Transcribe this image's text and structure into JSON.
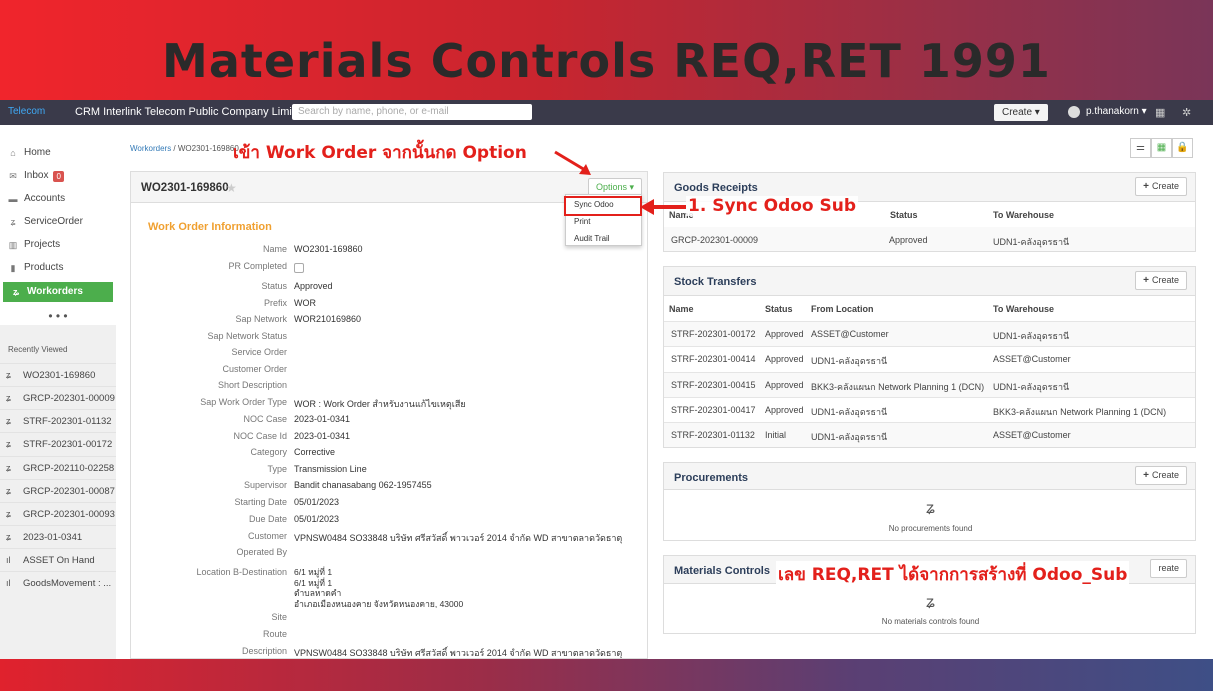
{
  "banner": {
    "title": "Materials Controls REQ,RET 1991"
  },
  "navbar": {
    "logo": "Telecom",
    "company": "CRM Interlink Telecom Public Company Limited",
    "search_placeholder": "Search by name, phone, or e-mail",
    "create_label": "Create ▾",
    "user": "p.thanakorn ▾"
  },
  "sidebar": {
    "items": [
      {
        "label": "Home",
        "icon": "home-icon"
      },
      {
        "label": "Inbox",
        "icon": "envelope-icon",
        "badge": "0"
      },
      {
        "label": "Accounts",
        "icon": "folder-icon"
      },
      {
        "label": "ServiceOrder",
        "icon": "z-icon"
      },
      {
        "label": "Projects",
        "icon": "briefcase-icon"
      },
      {
        "label": "Products",
        "icon": "box-icon"
      },
      {
        "label": "Workorders",
        "icon": "z-icon"
      }
    ],
    "more": "• • •",
    "recent_title": "Recently Viewed",
    "recent": [
      {
        "label": "WO2301-169860"
      },
      {
        "label": "GRCP-202301-00009"
      },
      {
        "label": "STRF-202301-01132"
      },
      {
        "label": "STRF-202301-00172"
      },
      {
        "label": "GRCP-202110-02258"
      },
      {
        "label": "GRCP-202301-00087"
      },
      {
        "label": "GRCP-202301-00093"
      },
      {
        "label": "2023-01-0341"
      },
      {
        "label": "ASSET On Hand"
      },
      {
        "label": "GoodsMovement : ..."
      }
    ]
  },
  "breadcrumb": {
    "link": "Workorders",
    "current": " / WO2301-169860"
  },
  "workorder": {
    "title": "WO2301-169860",
    "options_label": "Options ▾",
    "section_title": "Work Order Information",
    "fields": [
      {
        "label": "Name",
        "value": "WO2301-169860"
      },
      {
        "label": "PR Completed",
        "value": ""
      },
      {
        "label": "Status",
        "value": "Approved"
      },
      {
        "label": "Prefix",
        "value": "WOR"
      },
      {
        "label": "Sap Network",
        "value": "WOR210169860"
      },
      {
        "label": "Sap Network Status",
        "value": ""
      },
      {
        "label": "Service Order",
        "value": ""
      },
      {
        "label": "Customer Order",
        "value": ""
      },
      {
        "label": "Short Description",
        "value": ""
      },
      {
        "label": "Sap Work Order Type",
        "value": "WOR : Work Order สำหรับงานแก้ไขเหตุเสีย"
      },
      {
        "label": "NOC Case",
        "value": "2023-01-0341"
      },
      {
        "label": "NOC Case Id",
        "value": "2023-01-0341"
      },
      {
        "label": "Category",
        "value": "Corrective"
      },
      {
        "label": "Type",
        "value": "Transmission Line"
      },
      {
        "label": "Supervisor",
        "value": "Bandit chanasabang 062-1957455"
      },
      {
        "label": "Starting Date",
        "value": "05/01/2023"
      },
      {
        "label": "Due Date",
        "value": "05/01/2023"
      },
      {
        "label": "Customer",
        "value": "VPNSW0484 SO33848 บริษัท ศรีสวัสดิ์ พาวเวอร์ 2014 จำกัด WD สาขาตลาดวัดธาตุ"
      },
      {
        "label": "Operated By",
        "value": ""
      }
    ],
    "location_label": "Location B-Destination",
    "location_lines": [
      "6/1 หมู่ที่ 1",
      "6/1 หมู่ที่ 1",
      "ตำบลหาดคำ",
      "อำเภอเมืองหนองคาย จังหวัดหนองคาย, 43000"
    ],
    "site_label": "Site",
    "route_label": "Route",
    "description_label": "Description",
    "description_value": "VPNSW0484 SO33848 บริษัท ศรีสวัสดิ์ พาวเวอร์ 2014 จำกัด WD สาขาตลาดวัดธาตุ"
  },
  "options_menu": {
    "items": [
      "Sync Odoo",
      "Print",
      "Audit Trail"
    ]
  },
  "goods_receipts": {
    "title": "Goods Receipts",
    "create_label": "Create",
    "columns": [
      "Name",
      "Status",
      "To Warehouse"
    ],
    "rows": [
      [
        "GRCP-202301-00009",
        "Approved",
        "UDN1-คลังอุดรธานี"
      ]
    ]
  },
  "stock_transfers": {
    "title": "Stock Transfers",
    "create_label": "Create",
    "columns": [
      "Name",
      "Status",
      "From Location",
      "To Warehouse"
    ],
    "rows": [
      [
        "STRF-202301-00172",
        "Approved",
        "ASSET@Customer",
        "UDN1-คลังอุดรธานี"
      ],
      [
        "STRF-202301-00414",
        "Approved",
        "UDN1-คลังอุดรธานี",
        "ASSET@Customer"
      ],
      [
        "STRF-202301-00415",
        "Approved",
        "BKK3-คลังแผนก Network Planning 1 (DCN)",
        "UDN1-คลังอุดรธานี"
      ],
      [
        "STRF-202301-00417",
        "Approved",
        "UDN1-คลังอุดรธานี",
        "BKK3-คลังแผนก Network Planning 1 (DCN)"
      ],
      [
        "STRF-202301-01132",
        "Initial",
        "UDN1-คลังอุดรธานี",
        "ASSET@Customer"
      ]
    ]
  },
  "procurements": {
    "title": "Procurements",
    "create_label": "Create",
    "empty": "No procurements found"
  },
  "materials_controls": {
    "title": "Materials Controls",
    "create_label": "reate",
    "empty": "No materials controls found"
  },
  "annotations": {
    "a1": "เข้า Work Order จากนั้นกด Option",
    "a2": "1. Sync Odoo Sub",
    "a3": "เลข REQ,RET ได้จากการสร้างที่ Odoo_Sub"
  },
  "colors": {
    "accent_green": "#4cae4c",
    "annotation_red": "#e3201b",
    "section_orange": "#f0a030"
  }
}
